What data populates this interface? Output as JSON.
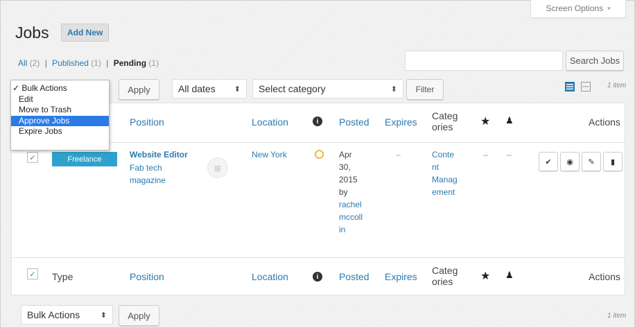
{
  "screen_options": {
    "label": "Screen Options",
    "arrow": "▾"
  },
  "page": {
    "title": "Jobs",
    "add_new": "Add New"
  },
  "filters": {
    "all": "All",
    "all_count": "(2)",
    "published": "Published",
    "published_count": "(1)",
    "pending": "Pending",
    "pending_count": "(1)",
    "sep": "|"
  },
  "search": {
    "placeholder": "",
    "button": "Search Jobs"
  },
  "toolbar": {
    "apply": "Apply",
    "dates": "All dates",
    "category": "Select category",
    "filter": "Filter",
    "items_count": "1 item",
    "bulk_actions": "Bulk Actions"
  },
  "bulk_menu": {
    "items": [
      "✓ Bulk Actions",
      "Edit",
      "Move to Trash",
      "Approve Jobs",
      "Expire Jobs"
    ],
    "selected": "Approve Jobs"
  },
  "columns": {
    "type": "Type",
    "position": "Position",
    "location": "Location",
    "info_icon": "info-icon",
    "posted": "Posted",
    "expires": "Expires",
    "categories_l1": "Categ",
    "categories_l2": "ories",
    "featured_icon": "star-icon",
    "filled_icon": "user-icon",
    "actions": "Actions"
  },
  "rows": [
    {
      "type": "Freelance",
      "position": "Website Editor",
      "company_l1": "Fab tech",
      "company_l2": "magazine",
      "location": "New York",
      "status_icon": "pending-clock-icon",
      "posted_lines": [
        "Apr",
        "30,",
        "2015",
        "by"
      ],
      "posted_by": [
        "rachel",
        "mccoll",
        "in"
      ],
      "expires": "–",
      "category_lines": [
        "Conte",
        "nt",
        "Manag",
        "ement"
      ],
      "featured": "–",
      "filled": "–",
      "actions": [
        "approve-check-icon",
        "view-eye-icon",
        "edit-pencil-icon",
        "delete-trash-icon"
      ]
    }
  ],
  "colors": {
    "link": "#2a7aaf",
    "badge": "#2ea2cc",
    "selected": "#2c7be5",
    "pending": "#f0b849"
  }
}
